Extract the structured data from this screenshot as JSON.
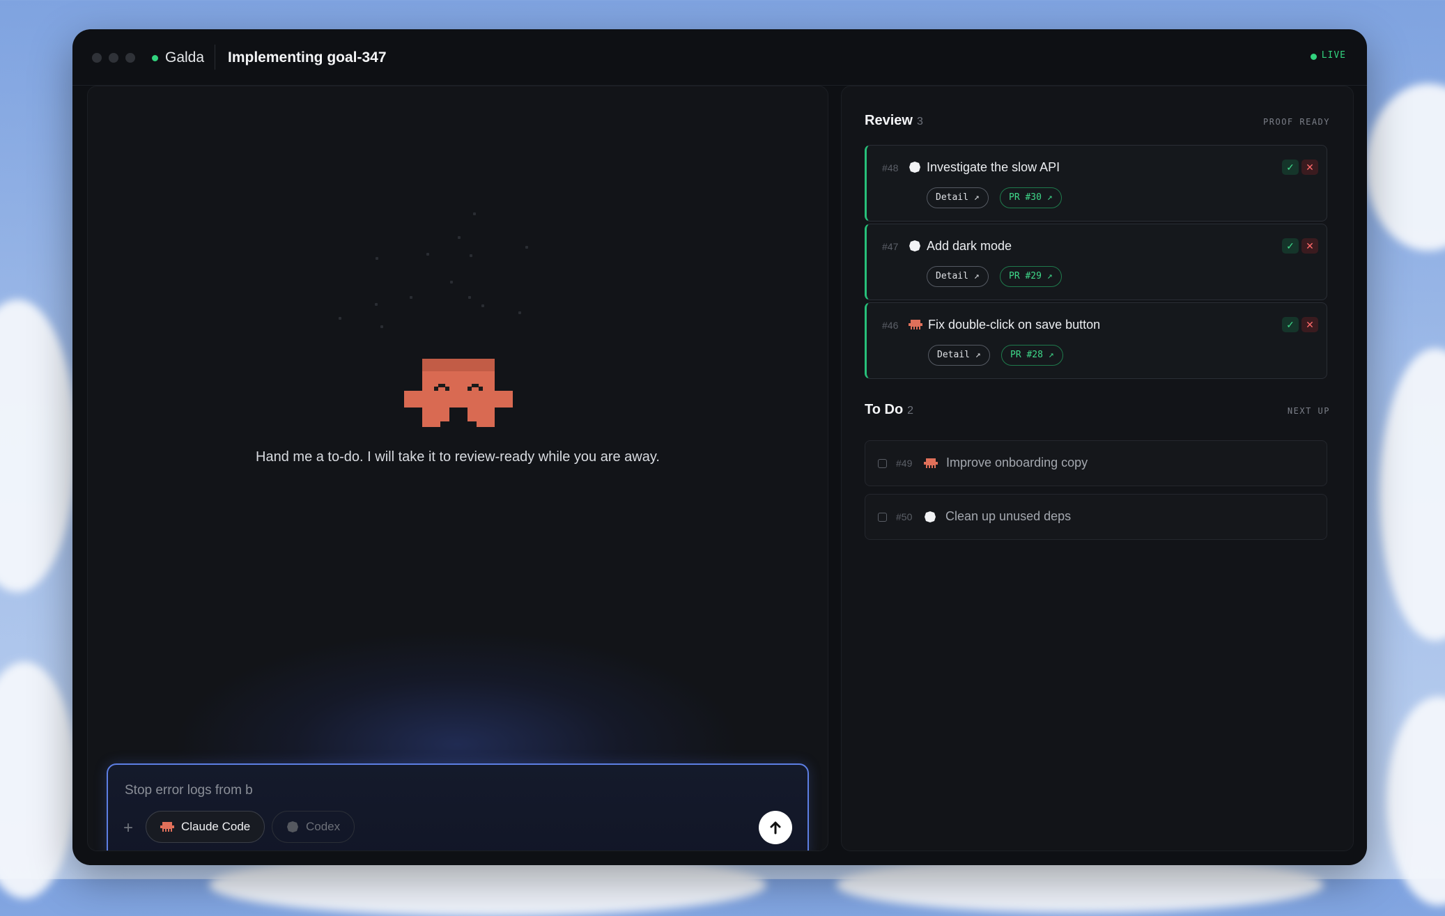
{
  "window": {
    "app_name": "Galda",
    "title": "Implementing goal-347",
    "status": "LIVE"
  },
  "hero": {
    "message": "Hand me a to-do. I will take it to review-ready while you are away."
  },
  "composer": {
    "value": "Stop error logs from b",
    "plus_label": "+",
    "agents": [
      {
        "label": "Claude Code",
        "icon": "claude-code-icon",
        "selected": true
      },
      {
        "label": "Codex",
        "icon": "codex-icon",
        "selected": false
      }
    ]
  },
  "review": {
    "title": "Review",
    "count": "3",
    "tag": "PROOF READY",
    "items": [
      {
        "num": "#48",
        "icon": "codex-icon",
        "title": "Investigate the slow API",
        "detail_label": "Detail ↗",
        "pr_label": "PR #30 ↗",
        "approve": "✓",
        "reject": "✕"
      },
      {
        "num": "#47",
        "icon": "codex-icon",
        "title": "Add dark mode",
        "detail_label": "Detail ↗",
        "pr_label": "PR #29 ↗",
        "approve": "✓",
        "reject": "✕"
      },
      {
        "num": "#46",
        "icon": "claude-code-icon",
        "title": "Fix double-click on save button",
        "detail_label": "Detail ↗",
        "pr_label": "PR #28 ↗",
        "approve": "✓",
        "reject": "✕"
      }
    ]
  },
  "todo": {
    "title": "To Do",
    "count": "2",
    "tag": "NEXT UP",
    "items": [
      {
        "num": "#49",
        "icon": "claude-code-icon",
        "title": "Improve onboarding copy"
      },
      {
        "num": "#50",
        "icon": "codex-icon",
        "title": "Clean up unused deps"
      }
    ]
  },
  "colors": {
    "accent_green": "#32d37e",
    "mascot": "#d96a52",
    "composer_border": "#5d7fe4"
  }
}
